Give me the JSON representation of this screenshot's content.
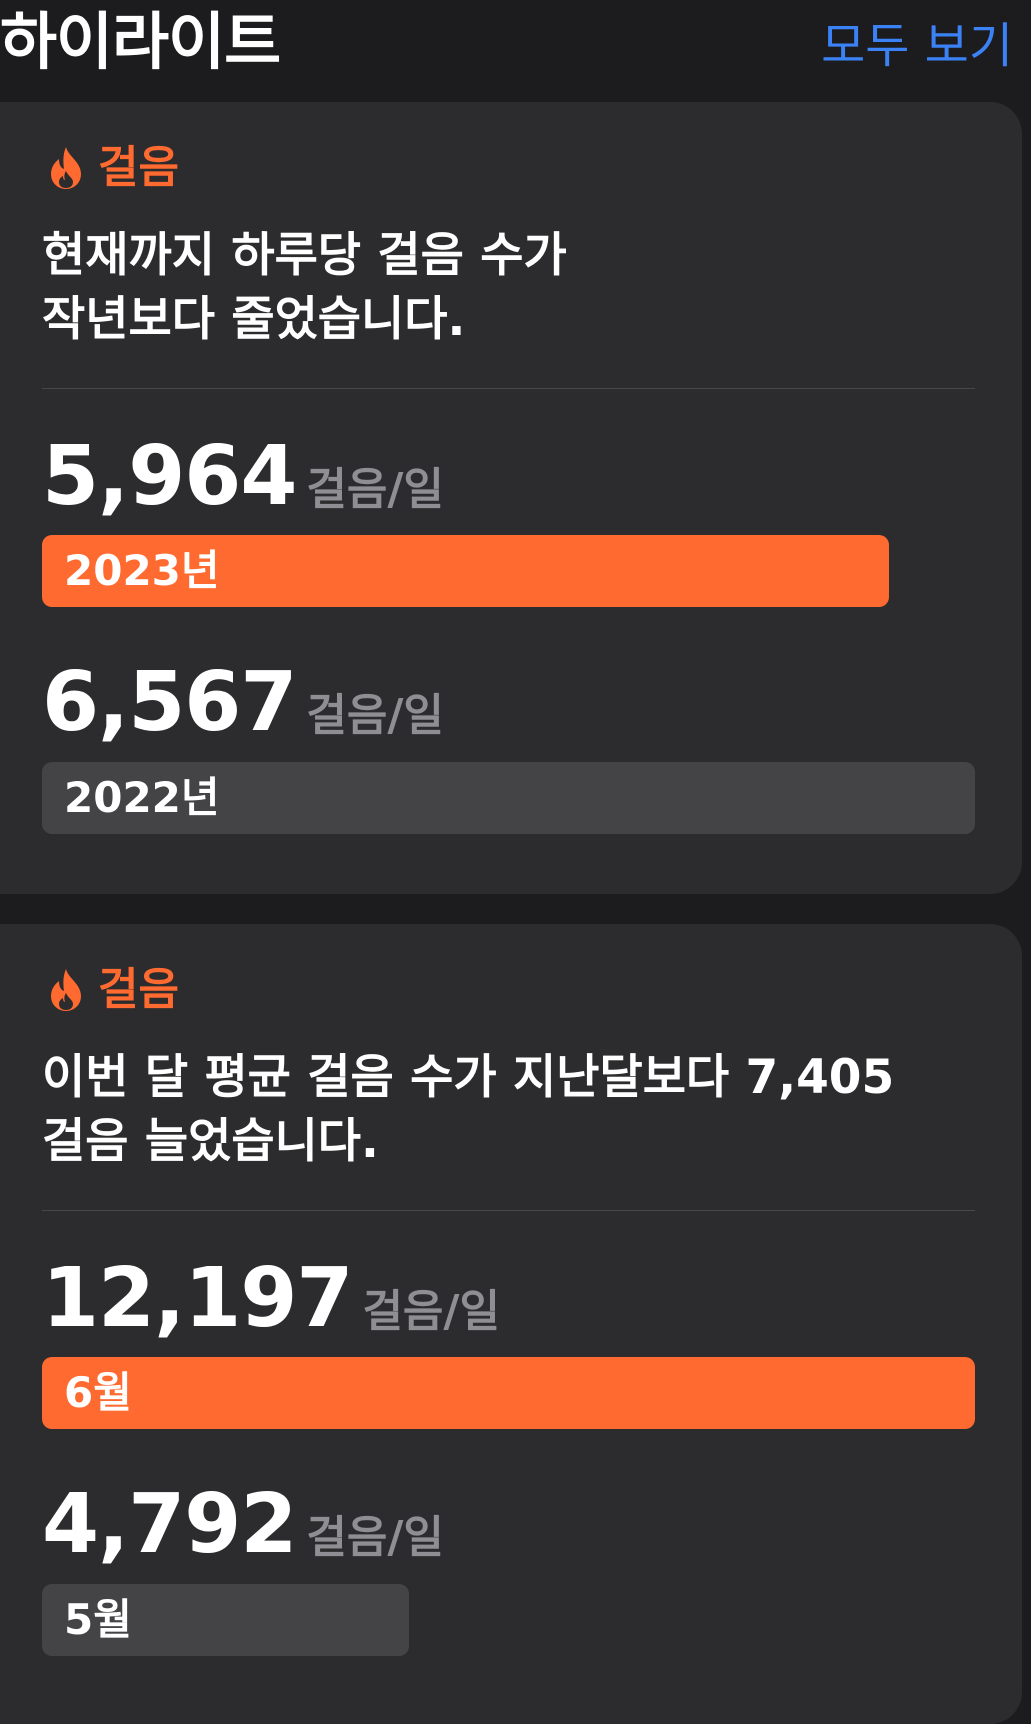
{
  "header": {
    "title": "하이라이트",
    "see_all": "모두 보기"
  },
  "colors": {
    "background": "#1c1c1e",
    "card": "#2c2c2e",
    "accent": "#ff6a30",
    "link": "#3b82f6",
    "bar_previous": "#444446",
    "unit_text": "#8e8e93"
  },
  "highlights": [
    {
      "category": "걸음",
      "icon": "flame-icon",
      "message": "현재까지 하루당 걸음 수가\n작년보다 줄었습니다.",
      "current": {
        "value": "5,964",
        "numeric": 5964,
        "unit": "걸음/일",
        "label": "2023년"
      },
      "previous": {
        "value": "6,567",
        "numeric": 6567,
        "unit": "걸음/일",
        "label": "2022년"
      }
    },
    {
      "category": "걸음",
      "icon": "flame-icon",
      "message": "이번 달 평균 걸음 수가 지난달보다 7,405\n걸음 늘었습니다.",
      "current": {
        "value": "12,197",
        "numeric": 12197,
        "unit": "걸음/일",
        "label": "6월"
      },
      "previous": {
        "value": "4,792",
        "numeric": 4792,
        "unit": "걸음/일",
        "label": "5월"
      }
    }
  ]
}
